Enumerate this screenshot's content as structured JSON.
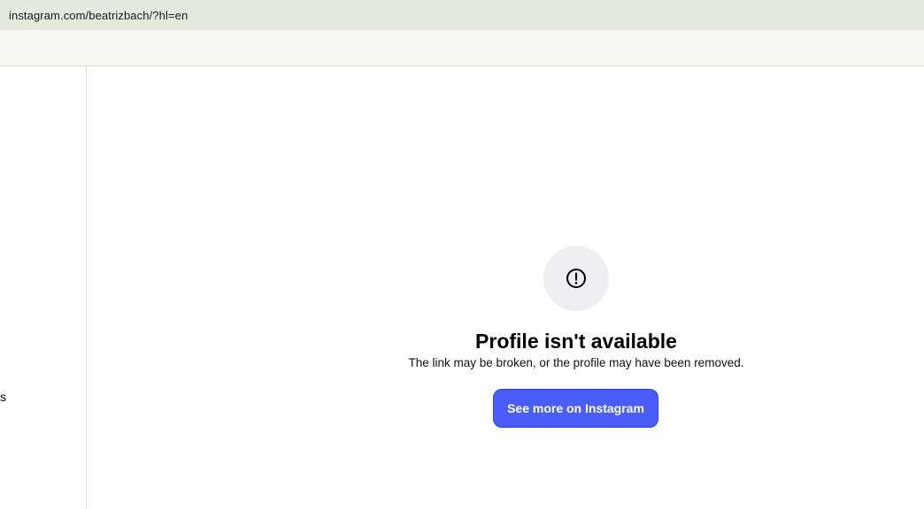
{
  "browser": {
    "url": "instagram.com/beatrizbach/?hl=en"
  },
  "sidebar": {
    "clipped_label": "s"
  },
  "error": {
    "icon": "alert-circle-icon",
    "title": "Profile isn't available",
    "subtitle": "The link may be broken, or the profile may have been removed.",
    "button_label": "See more on Instagram"
  },
  "colors": {
    "button": "#4a5df9",
    "icon_circle": "#efeff1",
    "address_bar": "#e4eadc"
  }
}
